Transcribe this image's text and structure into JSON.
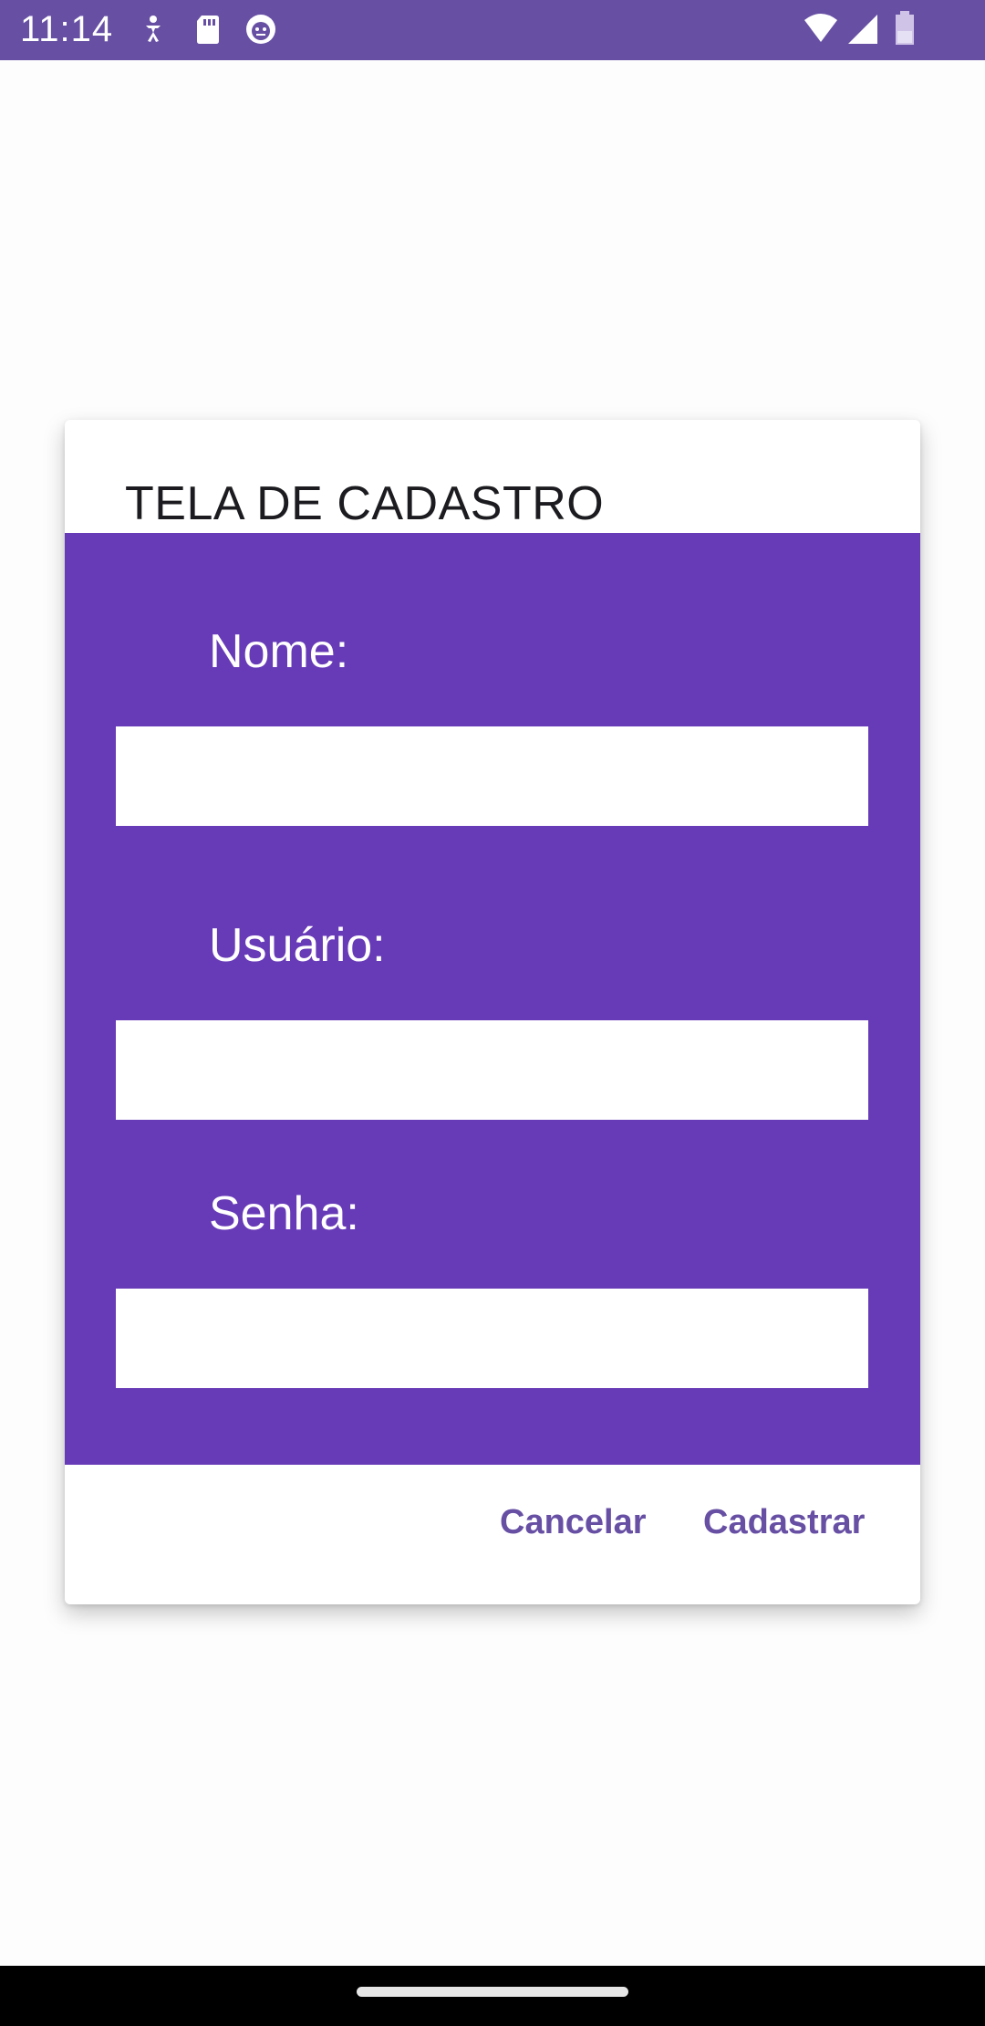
{
  "status_bar": {
    "time": "11:14",
    "left_icons": [
      "accessibility-icon",
      "sd-card-icon",
      "android-debug-icon"
    ],
    "right_icons": [
      "wifi-icon",
      "signal-icon",
      "battery-icon"
    ],
    "background": "#6750a4"
  },
  "dialog": {
    "title": "TELA DE CADASTRO",
    "panel_color": "#673ab7",
    "fields": [
      {
        "label": "Nome:",
        "value": "",
        "placeholder": ""
      },
      {
        "label": "Usuário:",
        "value": "",
        "placeholder": ""
      },
      {
        "label": "Senha:",
        "value": "",
        "placeholder": ""
      }
    ],
    "actions": {
      "cancel_label": "Cancelar",
      "submit_label": "Cadastrar",
      "color": "#6750a4"
    }
  },
  "nav_bar": {
    "home_indicator": "home-indicator"
  }
}
